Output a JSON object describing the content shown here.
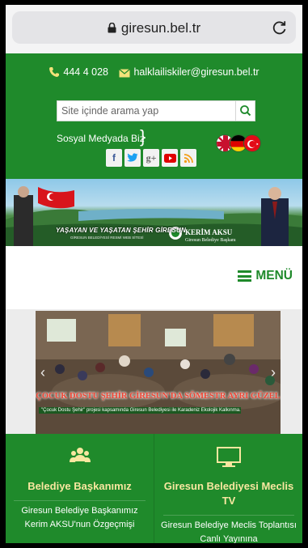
{
  "browser": {
    "url": "giresun.bel.tr"
  },
  "contact": {
    "phone": "444 4 028",
    "email": "halklailiskiler@giresun.bel.tr"
  },
  "search": {
    "placeholder": "Site içinde arama yap"
  },
  "social": {
    "label": "Sosyal Medyada Biz",
    "brace": "}",
    "items": [
      {
        "icon": "facebook-icon",
        "glyph": "f",
        "color": "#3b5998"
      },
      {
        "icon": "twitter-icon",
        "glyph": "t",
        "color": "#1da1f2"
      },
      {
        "icon": "google-plus-icon",
        "glyph": "g+",
        "color": "#777777"
      },
      {
        "icon": "youtube-icon",
        "glyph": "▶",
        "color": "#e00000"
      },
      {
        "icon": "rss-icon",
        "glyph": "≋",
        "color": "#f39c12"
      }
    ]
  },
  "languages": [
    {
      "icon": "english-flag-icon"
    },
    {
      "icon": "german-flag-icon"
    },
    {
      "icon": "turkish-flag-icon"
    }
  ],
  "banner": {
    "slogan": "YAŞAYAN VE YAŞATAN ŞEHİR GİRESUN",
    "slogan_sub": "GİRESUN BELEDİYESİ RESMİ WEB SİTESİ",
    "mayor_name": "KERİM AKSU",
    "mayor_title": "Giresun Belediye Başkanı"
  },
  "menu": {
    "label": "MENÜ"
  },
  "slider": {
    "caption": "ÇOCUK DOSTU ŞEHİR GİRESUN'DA SÖMESTR AYRI GÜZEL",
    "sub": "\"Çocuk Dostu Şehir\" projesi kapsamında Giresun Belediyesi ile Karadeniz Ekolojik Kalkınma...",
    "prev": "‹",
    "next": "›"
  },
  "cards": [
    {
      "icon": "people-icon",
      "title": "Belediye Başkanımız",
      "text": "Giresun Belediye Başkanımız Kerim AKSU'nun Özgeçmişi"
    },
    {
      "icon": "monitor-icon",
      "title": "Giresun Belediyesi Meclis TV",
      "text": "Giresun Belediye Meclis Toplantısı Canlı Yayınına"
    }
  ],
  "colors": {
    "brand_green": "#1f8a2b",
    "card_title": "#f8e7a0",
    "caption_red": "#ee4433"
  }
}
